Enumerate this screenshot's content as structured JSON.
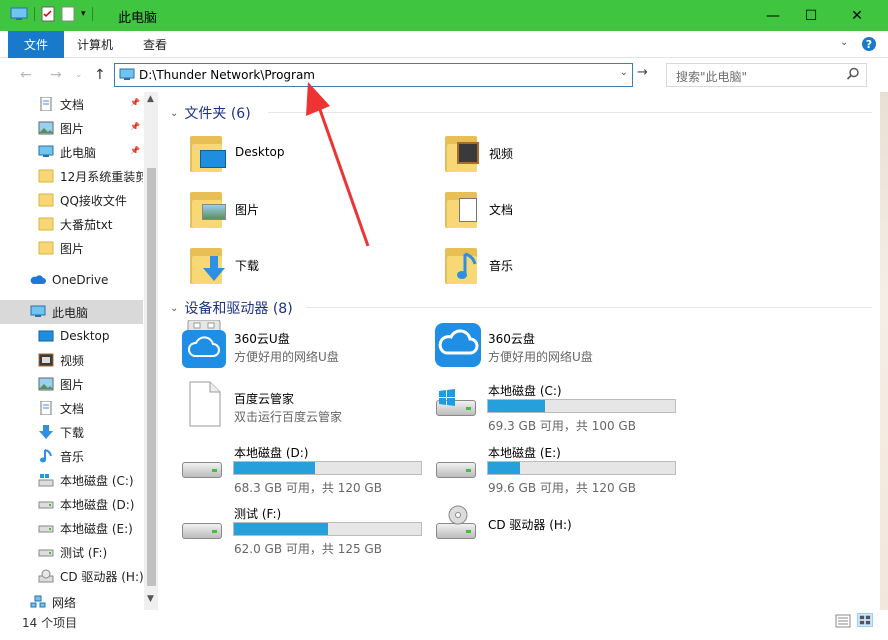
{
  "window": {
    "title": "此电脑",
    "minimize": "—",
    "maximize": "☐",
    "close": "✕"
  },
  "ribbon": {
    "tabs": [
      "文件",
      "计算机",
      "查看"
    ]
  },
  "address": {
    "path": "D:\\Thunder Network\\Program"
  },
  "search": {
    "placeholder": "搜索\"此电脑\""
  },
  "sidebar": {
    "items": [
      {
        "label": "文档",
        "icon": "document-icon",
        "pinned": true
      },
      {
        "label": "图片",
        "icon": "picture-icon",
        "pinned": true
      },
      {
        "label": "此电脑",
        "icon": "computer-icon",
        "pinned": true
      },
      {
        "label": "12月系统重装剪",
        "icon": "folder-icon",
        "pinned": false
      },
      {
        "label": "QQ接收文件",
        "icon": "folder-icon",
        "pinned": false
      },
      {
        "label": "大番茄txt",
        "icon": "folder-icon",
        "pinned": false
      },
      {
        "label": "图片",
        "icon": "folder-icon",
        "pinned": false
      },
      {
        "label": "OneDrive",
        "icon": "cloud-icon",
        "pinned": false
      },
      {
        "label": "此电脑",
        "icon": "computer-icon",
        "pinned": false,
        "selected": true
      },
      {
        "label": "Desktop",
        "icon": "desktop-icon",
        "pinned": false
      },
      {
        "label": "视频",
        "icon": "video-icon",
        "pinned": false
      },
      {
        "label": "图片",
        "icon": "picture-icon",
        "pinned": false
      },
      {
        "label": "文档",
        "icon": "document-icon",
        "pinned": false
      },
      {
        "label": "下载",
        "icon": "download-icon",
        "pinned": false
      },
      {
        "label": "音乐",
        "icon": "music-icon",
        "pinned": false
      },
      {
        "label": "本地磁盘 (C:)",
        "icon": "windows-drive-icon",
        "pinned": false
      },
      {
        "label": "本地磁盘 (D:)",
        "icon": "drive-icon",
        "pinned": false
      },
      {
        "label": "本地磁盘 (E:)",
        "icon": "drive-icon",
        "pinned": false
      },
      {
        "label": "测试 (F:)",
        "icon": "drive-icon",
        "pinned": false
      },
      {
        "label": "CD 驱动器 (H:)",
        "icon": "cd-drive-icon",
        "pinned": false
      },
      {
        "label": "网络",
        "icon": "network-icon",
        "pinned": false
      }
    ]
  },
  "folders": {
    "header": "文件夹 (6)",
    "items": [
      "Desktop",
      "视频",
      "图片",
      "文档",
      "下载",
      "音乐"
    ]
  },
  "devices": {
    "header": "设备和驱动器 (8)",
    "items": [
      {
        "name": "360云U盘",
        "sub": "方便好用的网络U盘"
      },
      {
        "name": "360云盘",
        "sub": "方便好用的网络U盘"
      },
      {
        "name": "百度云管家",
        "sub": "双击运行百度云管家"
      },
      {
        "name": "本地磁盘 (C:)",
        "sub": "69.3 GB 可用，共 100 GB",
        "used_fraction": 0.307
      },
      {
        "name": "本地磁盘 (D:)",
        "sub": "68.3 GB 可用，共 120 GB",
        "used_fraction": 0.431
      },
      {
        "name": "本地磁盘 (E:)",
        "sub": "99.6 GB 可用，共 120 GB",
        "used_fraction": 0.17
      },
      {
        "name": "测试 (F:)",
        "sub": "62.0 GB 可用，共 125 GB",
        "used_fraction": 0.504
      },
      {
        "name": "CD 驱动器 (H:)",
        "sub": ""
      }
    ]
  },
  "status": {
    "count": "14 个项目"
  },
  "colors": {
    "titlebar": "#3fc53f",
    "accent": "#1979ca",
    "bar_fill": "#26a0da",
    "annotation_arrow": "#ee3333"
  }
}
